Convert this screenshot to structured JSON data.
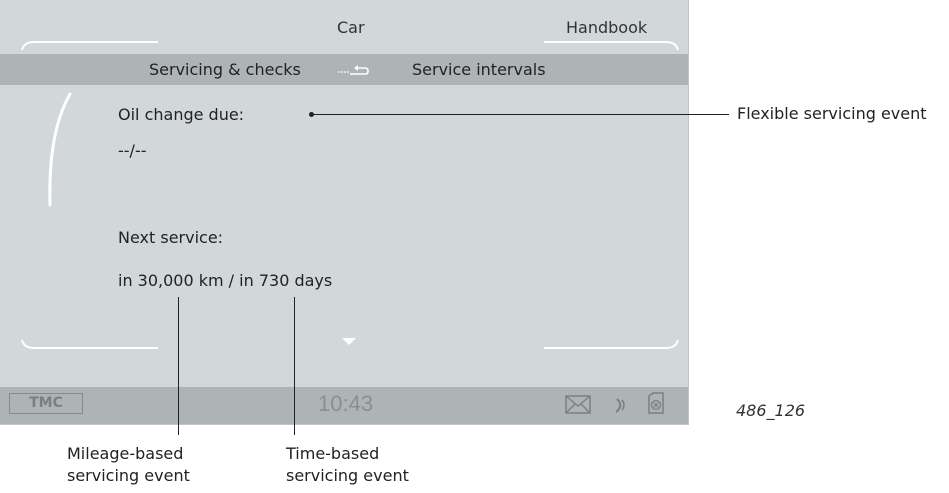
{
  "top_menu": {
    "left": "Car",
    "right": "Handbook"
  },
  "sub_menu": {
    "left": "Servicing & checks",
    "right": "Service intervals"
  },
  "content": {
    "oil_label": "Oil change due:",
    "oil_value": "--/--",
    "next_label": "Next service:",
    "next_value": "in 30,000 km / in 730 days"
  },
  "status_bar": {
    "tmc": "TMC",
    "time": "10:43"
  },
  "callouts": {
    "flexible": "Flexible servicing event",
    "mileage_line1": "Mileage-based",
    "mileage_line2": "servicing event",
    "time_line1": "Time-based",
    "time_line2": "servicing event"
  },
  "figure_number": "486_126",
  "icons": [
    "return-arrow-icon",
    "down-arrow-icon",
    "envelope-icon",
    "phone-signal-icon",
    "sim-card-icon"
  ],
  "colors": {
    "screen_bg": "#d2d7d9",
    "bar_bg": "#aeb3b6"
  }
}
